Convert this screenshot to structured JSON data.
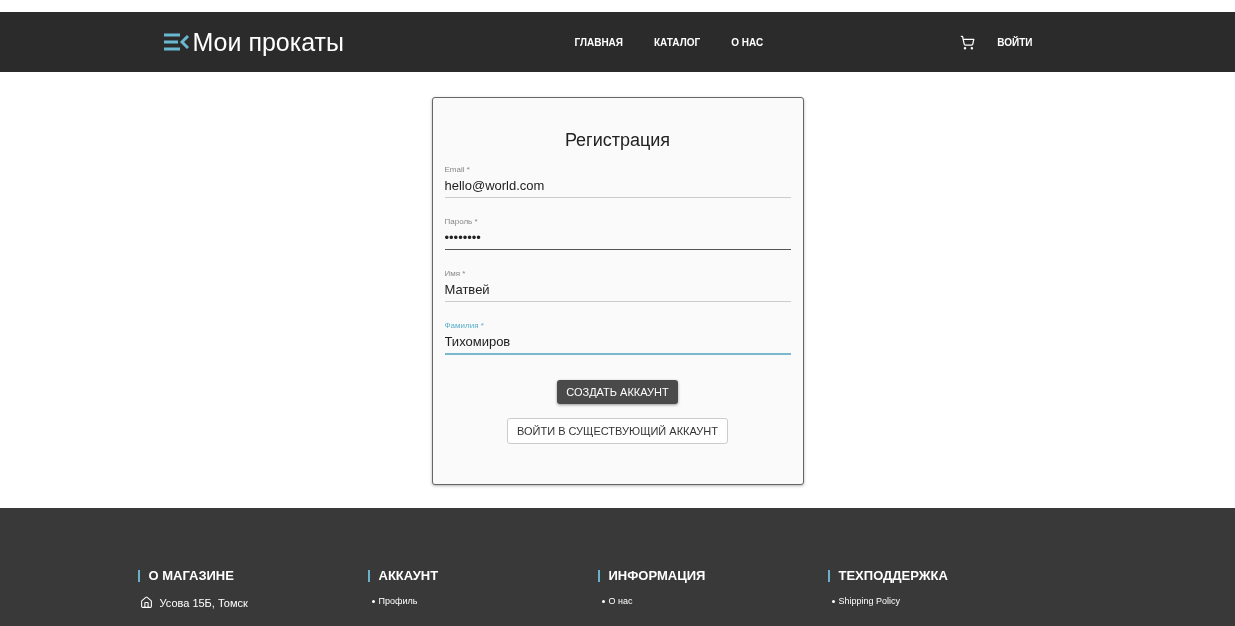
{
  "header": {
    "logo": "Мои прокаты",
    "nav": [
      {
        "label": "ГЛАВНАЯ"
      },
      {
        "label": "КАТАЛОГ"
      },
      {
        "label": "О НАС"
      }
    ],
    "login": "ВОЙТИ"
  },
  "form": {
    "title": "Регистрация",
    "fields": [
      {
        "label": "Email *",
        "value": "hello@world.com",
        "focused": false,
        "hovered": false
      },
      {
        "label": "Пароль *",
        "value": "••••••••",
        "focused": false,
        "hovered": true
      },
      {
        "label": "Имя *",
        "value": "Матвей",
        "focused": false,
        "hovered": false
      },
      {
        "label": "Фамилия *",
        "value": "Тихомиров",
        "focused": true,
        "hovered": false
      }
    ],
    "submit": "СОЗДАТЬ АККАУНТ",
    "secondary": "ВОЙТИ В СУЩЕСТВУЮЩИЙ АККАУНТ"
  },
  "footer": {
    "columns": [
      {
        "heading": "О МАГАЗИНЕ",
        "items": [
          {
            "kind": "address",
            "text": "Усова 15Б, Томск"
          }
        ]
      },
      {
        "heading": "АККАУНТ",
        "items": [
          {
            "kind": "link",
            "text": "Профиль"
          }
        ]
      },
      {
        "heading": "ИНФОРМАЦИЯ",
        "items": [
          {
            "kind": "link",
            "text": "О нас"
          }
        ]
      },
      {
        "heading": "ТЕХПОДДЕРЖКА",
        "items": [
          {
            "kind": "link",
            "text": "Shipping Policy"
          }
        ]
      }
    ]
  }
}
